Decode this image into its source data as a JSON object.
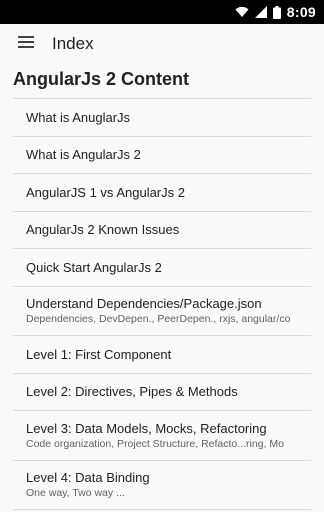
{
  "status_bar": {
    "time": "8:09"
  },
  "app_bar": {
    "title": "Index"
  },
  "section": {
    "title": "AngularJs 2 Content"
  },
  "items": [
    {
      "label": "What is AnuglarJs",
      "sub": ""
    },
    {
      "label": "What is AngularJs 2",
      "sub": ""
    },
    {
      "label": "AngularJS 1 vs AngularJs 2",
      "sub": ""
    },
    {
      "label": "AngularJs 2 Known Issues",
      "sub": ""
    },
    {
      "label": "Quick Start AngularJs 2",
      "sub": ""
    },
    {
      "label": "Understand Dependencies/Package.json",
      "sub": "Dependencies, DevDepen., PeerDepen., rxjs, angular/co"
    },
    {
      "label": "Level 1: First Component",
      "sub": ""
    },
    {
      "label": "Level 2: Directives, Pipes & Methods",
      "sub": ""
    },
    {
      "label": "Level 3: Data Models, Mocks, Refactoring",
      "sub": "Code organization, Project Structure, Refacto...ring, Mo"
    },
    {
      "label": "Level 4: Data Binding",
      "sub": "One way, Two way ..."
    }
  ]
}
